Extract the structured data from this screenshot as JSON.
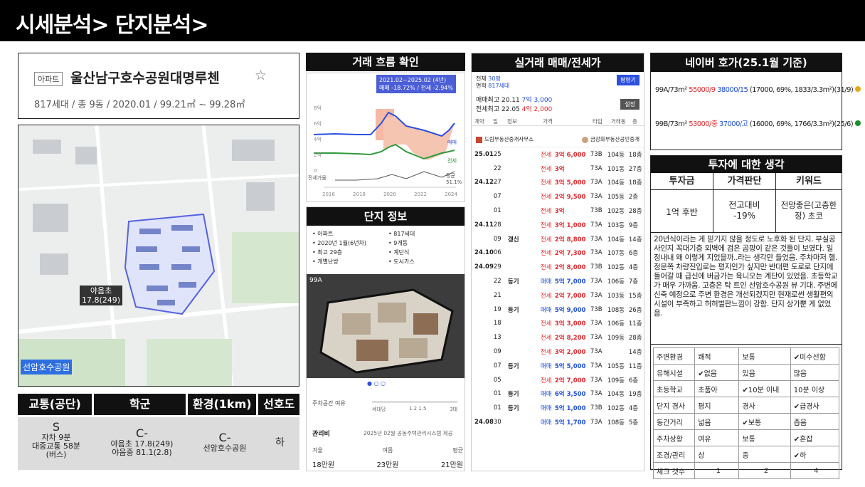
{
  "header": {
    "title": "시세분석> 단지분석>"
  },
  "apt": {
    "badge": "아파트",
    "name": "울산남구호수공원대명루첸",
    "star": "☆",
    "info": "817세대 / 총 9동 / 2020.01 / 99.21㎡ ~ 99.28㎡"
  },
  "map": {
    "school_label_1": "야음초",
    "school_label_2": "17.8(249)",
    "park_label": "선암호수공원"
  },
  "grades": {
    "headers": [
      "교통(공단)",
      "학군",
      "환경(1km)",
      "선호도"
    ],
    "transport": {
      "grade": "S",
      "l1": "자차 9분",
      "l2": "대중교통 58분",
      "l3": "(버스)"
    },
    "school": {
      "grade": "C-",
      "l1": "야음초 17.8(249)",
      "l2": "야음중 81.1(2.8)"
    },
    "env": {
      "grade": "C-",
      "l1": "선암호수공원"
    },
    "pref": {
      "grade": "하"
    }
  },
  "flow": {
    "title": "거래 흐름 확인",
    "tip_line1": "2021.02~2025.02 (4년)",
    "tip_line2": "매매 -18.72% / 전세 -2.94%",
    "y_labels": [
      "8억",
      "6억",
      "4억",
      "2억",
      "0"
    ],
    "x_labels": [
      "2016",
      "2018",
      "2020",
      "2022",
      "2024"
    ],
    "legend_sale": "매매",
    "legend_lease": "전세",
    "legend_gap1": "평균",
    "legend_gap2": "51.1%",
    "gap_label": "전세가율"
  },
  "complex": {
    "title": "단지 정보",
    "items": [
      "아파트",
      "817세대",
      "2020년 1월(6년차)",
      "9개동",
      "최고 29층",
      "계단식",
      "개별난방",
      "도시가스"
    ],
    "plan_label": "99A",
    "parking_label": "주차공간 여유",
    "parking_ticks": [
      "세대당",
      "1.2 1.5",
      "3대"
    ],
    "fee_label": "관리비",
    "fee_desc": "2025년 02월 공동주택관리시스템 제공",
    "fee_heads": [
      "겨울",
      "여름",
      "평균"
    ],
    "fee_vals": [
      "18만원",
      "23만원",
      "21만원"
    ]
  },
  "deals": {
    "title": "실거래 매매/전세가",
    "size_label": "전체",
    "size_val": "30평",
    "area_label": "면적",
    "area_val": "817세대",
    "btn1": "평형기",
    "btn2": "설정",
    "max_sale_label": "매매최고",
    "max_sale_date": "20.11",
    "max_sale_price": "7억 3,000",
    "max_lease_label": "전세최고",
    "max_lease_date": "22.05",
    "max_lease_price": "4억 2,000",
    "cols": [
      "계약",
      "일",
      "정보",
      "가격",
      "타입",
      "거래동",
      "층"
    ],
    "agent1": "드림부동산중개사무소",
    "agent2": "금강화부동산공인중개",
    "rows": [
      [
        "25.01",
        "25",
        "",
        "전세",
        "3억 6,000",
        "73B",
        "104동",
        "18층"
      ],
      [
        "",
        "22",
        "",
        "전세",
        "3억",
        "73A",
        "101동",
        "27층"
      ],
      [
        "24.12",
        "27",
        "",
        "전세",
        "3억 5,000",
        "73A",
        "104동",
        "18층"
      ],
      [
        "",
        "07",
        "",
        "전세",
        "2억 9,500",
        "73A",
        "105동",
        "2층"
      ],
      [
        "",
        "01",
        "",
        "전세",
        "3억",
        "73B",
        "102동",
        "28층"
      ],
      [
        "24.11",
        "28",
        "",
        "전세",
        "3억 1,000",
        "73A",
        "103동",
        "9층"
      ],
      [
        "",
        "09",
        "갱신",
        "전세",
        "2억 8,800",
        "73A",
        "104동",
        "14층"
      ],
      [
        "24.10",
        "06",
        "",
        "전세",
        "2억 7,300",
        "73A",
        "107동",
        "6층"
      ],
      [
        "24.09",
        "29",
        "",
        "전세",
        "2억 8,000",
        "73B",
        "102동",
        "4층"
      ],
      [
        "",
        "22",
        "등기",
        "매매",
        "5억 7,000",
        "73A",
        "106동",
        "7층"
      ],
      [
        "",
        "21",
        "",
        "전세",
        "2억 7,000",
        "73A",
        "103동",
        "15층"
      ],
      [
        "",
        "19",
        "등기",
        "매매",
        "5억 9,000",
        "73B",
        "108동",
        "26층"
      ],
      [
        "",
        "18",
        "",
        "전세",
        "3억 3,000",
        "73A",
        "106동",
        "11층"
      ],
      [
        "",
        "13",
        "",
        "전세",
        "2억 8,200",
        "73A",
        "109동",
        "28층"
      ],
      [
        "",
        "09",
        "",
        "전세",
        "3억 2,000",
        "73A",
        "",
        "14층"
      ],
      [
        "",
        "07",
        "등기",
        "매매",
        "5억 5,000",
        "73A",
        "105동",
        "11층"
      ],
      [
        "",
        "05",
        "",
        "전세",
        "2억 7,000",
        "73A",
        "109동",
        "6층"
      ],
      [
        "",
        "01",
        "등기",
        "매매",
        "6억 3,500",
        "73A",
        "104동",
        "19층"
      ],
      [
        "",
        "01",
        "등기",
        "매매",
        "5억 1,000",
        "73B",
        "102동",
        "4층"
      ],
      [
        "24.08",
        "30",
        "",
        "매매",
        "5억 1,700",
        "73A",
        "108동",
        "5층"
      ]
    ]
  },
  "naver": {
    "title": "네이버 호가(25.1월 기준)",
    "r1": {
      "type": "99A/73m²",
      "sale": "55000/9",
      "lease": "38000/15",
      "rest": "(17000, 69%, 1833/3.3m²)(31/9)",
      "dot": "#e6a817"
    },
    "r2": {
      "type": "99B/73m²",
      "sale": "53000/중",
      "lease": "37000/고",
      "rest": "(16000, 69%, 1766/3.3m²)(25/6)",
      "dot": "#1a8f2a"
    }
  },
  "invest": {
    "title": "투자에 대한 생각",
    "heads": [
      "투자금",
      "가격판단",
      "키워드"
    ],
    "amount": "1억 후반",
    "price_l1": "전고대비",
    "price_l2": "-19%",
    "keyword": "전망좋은(고층한정) 초코",
    "memo": "20년식이라는 게 믿기지 않을 정도로 노후화 된 단지. 부실공사인지 꼭대기층 외벽에 검은 곰팡이 같은 것들이 보였다. 일정내내 왜 이렇게 지었을까..라는 생각만 들었음. 주차마저 헬. 정문쪽 차량진입로는 평지인가 싶지만 반대편 도로로 단지에 들어갈 때 급신에 버금가는 육니오는 계단이 있었음. 초등학교가 매우 가까움. 고층은 탁 트인 선암호수공원 뷰 기대. 주변에 신축 예정으로 주변 환경은 개선되겠지만 현재로썬 생활편의시설이 부족하고 허허벌판느낌이 강함. 단지 상가뿐 게 없었음."
  },
  "check": {
    "rows": [
      [
        "주변환경",
        "쾌적",
        "보통",
        "✔미수선함"
      ],
      [
        "유해시설",
        "✔없음",
        "있음",
        "많음"
      ],
      [
        "초등학교",
        "초품아",
        "✔10분 이내",
        "10분 이상"
      ],
      [
        "단지 경사",
        "평지",
        "경사",
        "✔급경사"
      ],
      [
        "동간거리",
        "넓음",
        "✔보통",
        "좁음"
      ],
      [
        "주차상황",
        "여유",
        "보통",
        "✔혼잡"
      ],
      [
        "조경/관리",
        "상",
        "중",
        "✔하"
      ],
      [
        "체크 갯수",
        "1",
        "2",
        "4"
      ]
    ]
  }
}
